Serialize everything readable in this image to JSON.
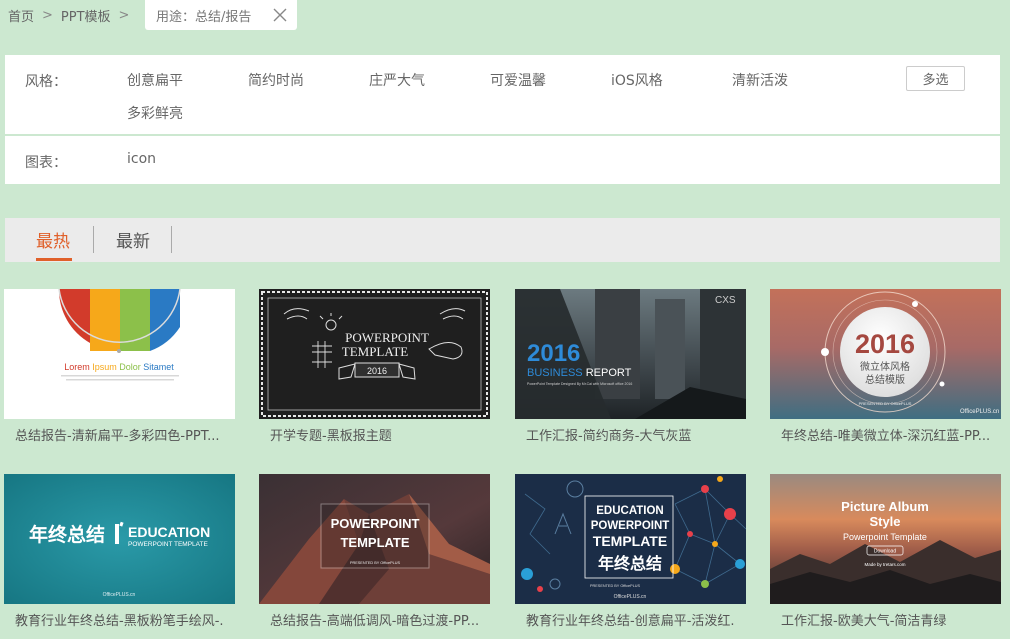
{
  "breadcrumb": {
    "items": [
      "首页",
      "PPT模板"
    ],
    "separator": ">"
  },
  "active_filter_tag": {
    "label": "用途：总结/报告"
  },
  "filters": {
    "style": {
      "label": "风格：",
      "options": [
        "创意扁平",
        "简约时尚",
        "庄严大气",
        "可爱温馨",
        "iOS风格",
        "清新活泼",
        "多彩鲜亮"
      ],
      "multi_select_label": "多选"
    },
    "chart": {
      "label": "图表：",
      "options": [
        "icon"
      ]
    }
  },
  "sort_tabs": {
    "items": [
      "最热",
      "最新"
    ],
    "active_index": 0,
    "accent": "#e0602a"
  },
  "templates": [
    {
      "title": "总结报告-清新扁平-多彩四色-PPT...",
      "thumb_text": {
        "heading_parts": [
          "Lorem ",
          "Ipsum ",
          "Dolor ",
          "Sitamet"
        ]
      }
    },
    {
      "title": "开学专题-黑板报主题",
      "thumb_text": {
        "line1": "POWERPOINT",
        "line2": "TEMPLATE",
        "year": "2016"
      }
    },
    {
      "title": "工作汇报-简约商务-大气灰蓝",
      "thumb_text": {
        "year": "2016",
        "business": "BUSINESS",
        "report": " REPORT",
        "brand": "CXS",
        "caption": "PowerPoint Template Designed By Mr.Cai with Microsoft office 2016"
      }
    },
    {
      "title": "年终总结-唯美微立体-深沉红蓝-PP...",
      "thumb_text": {
        "year": "2016",
        "sub1": "微立体风格",
        "sub2": "总结模版",
        "presented": "PRESENTED BY OfficePLUS",
        "brand": "OfficePLUS.cn"
      }
    },
    {
      "title": "教育行业年终总结-黑板粉笔手绘风-...",
      "thumb_text": {
        "cn": "年终总结",
        "en1": "EDUCATION",
        "en2": "POWERPOINT TEMPLATE",
        "brand": "OfficePLUS.cn"
      }
    },
    {
      "title": "总结报告-高端低调风-暗色过渡-PP...",
      "thumb_text": {
        "line1": "POWERPOINT",
        "line2": "TEMPLATE",
        "presented": "PRESENTED BY OfficePLUS"
      }
    },
    {
      "title": "教育行业年终总结-创意扁平-活泼红...",
      "thumb_text": {
        "line1": "EDUCATION",
        "line2": "POWERPOINT",
        "line3": "TEMPLATE",
        "cn": "年终总结",
        "presented": "PRESENTED BY OfficePLUS",
        "brand": "OfficePLUS.cn"
      }
    },
    {
      "title": "工作汇报-欧美大气-简洁青绿",
      "thumb_text": {
        "line1": "Picture Album",
        "line2": "Style",
        "sub": "Powerpoint Template",
        "button": "Download",
        "made": "Made by tretars.com"
      }
    }
  ],
  "colors": {
    "page_bg": "#cce8d0",
    "panel_bg": "#ffffff",
    "tab_bar_bg": "#ebebeb",
    "accent": "#e0602a"
  }
}
